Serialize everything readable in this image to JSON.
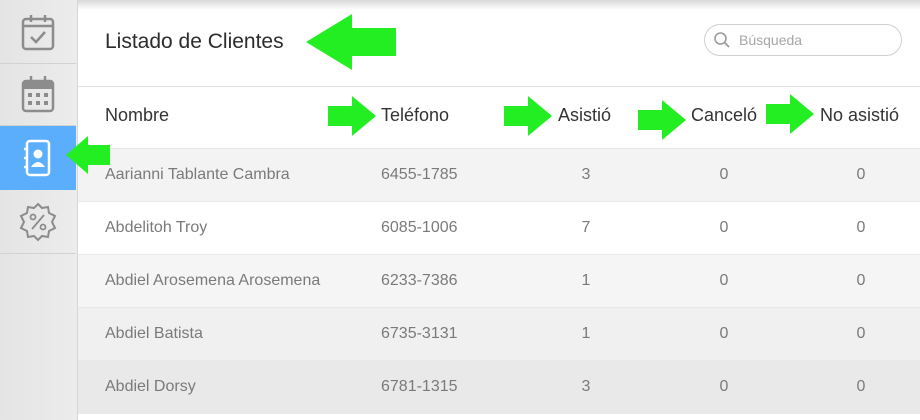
{
  "sidebar": {
    "items": [
      {
        "icon": "calendar-check-icon",
        "active": false
      },
      {
        "icon": "calendar-grid-icon",
        "active": false
      },
      {
        "icon": "contact-book-icon",
        "active": true
      },
      {
        "icon": "discount-badge-icon",
        "active": false
      }
    ],
    "active_color": "#5aaefc"
  },
  "header": {
    "title": "Listado de Clientes"
  },
  "search": {
    "placeholder": "Búsqueda",
    "value": ""
  },
  "table": {
    "columns": [
      "Nombre",
      "Teléfono",
      "Asistió",
      "Canceló",
      "No asistió"
    ],
    "rows": [
      {
        "name": "Aarianni Tablante Cambra",
        "phone": "6455-1785",
        "attended": "3",
        "cancelled": "0",
        "no_show": "0"
      },
      {
        "name": "Abdelitoh Troy",
        "phone": "6085-1006",
        "attended": "7",
        "cancelled": "0",
        "no_show": "0"
      },
      {
        "name": "Abdiel Arosemena Arosemena",
        "phone": "6233-7386",
        "attended": "1",
        "cancelled": "0",
        "no_show": "0"
      },
      {
        "name": "Abdiel Batista",
        "phone": "6735-3131",
        "attended": "1",
        "cancelled": "0",
        "no_show": "0"
      },
      {
        "name": "Abdiel Dorsy",
        "phone": "6781-1315",
        "attended": "3",
        "cancelled": "0",
        "no_show": "0"
      }
    ]
  },
  "annotations": {
    "arrow_color": "#22ee22"
  }
}
